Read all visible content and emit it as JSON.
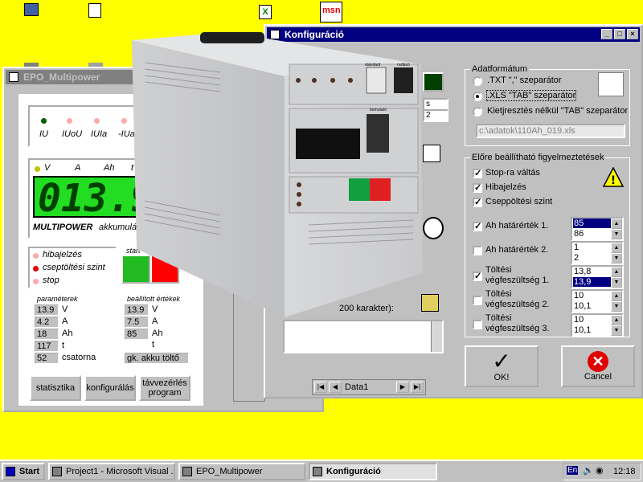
{
  "desktop": {
    "bg": "#ffff00",
    "msn_label": "msn"
  },
  "main_window": {
    "title": "EPO_Multipower",
    "indicators": [
      "IU",
      "IUoU",
      "IUIa",
      "-IUa"
    ],
    "meter_labels": [
      "V",
      "A",
      "Ah",
      "t"
    ],
    "display_value": "013.9",
    "brand": "MULTIPOWER",
    "brand_sub": "akkumuláto",
    "status_items": [
      "hibajelzés",
      "cseptöltési szint",
      "stop"
    ],
    "start_label": "start",
    "params_title": "paraméterek",
    "params": [
      {
        "value": "13.9",
        "unit": "V"
      },
      {
        "value": "4.2",
        "unit": "A"
      },
      {
        "value": "18",
        "unit": "Ah"
      },
      {
        "value": "117",
        "unit": "t"
      },
      {
        "value": "52",
        "unit": "csatorna"
      }
    ],
    "settings_title": "beállított értékek",
    "settings": [
      {
        "value": "13.9",
        "unit": "V"
      },
      {
        "value": "7.5",
        "unit": "A"
      },
      {
        "value": "85",
        "unit": "Ah"
      },
      {
        "value": "",
        "unit": "t"
      },
      {
        "value": "gk. akku töltő",
        "unit": ""
      }
    ],
    "btn_stat": "statisztika",
    "btn_config": "konfigurálás",
    "btn_remote": "távvezérlés program"
  },
  "config_window": {
    "title": "Konfiguráció",
    "data_format_title": "Adatformátum",
    "radio_options": [
      {
        "label": ".TXT  \",\" szeparátor",
        "selected": false
      },
      {
        "label": ".XLS \"TAB\" szeparátor",
        "selected": true
      },
      {
        "label": "Kietjresztés nélkül \"TAB\" szeparátor",
        "selected": false
      }
    ],
    "file_path": "c:\\adatok\\110Ah_019.xls",
    "warnings_title": "Előre beállítható figyelmeztetések",
    "checks": [
      {
        "label": "Stop-ra váltás",
        "checked": true
      },
      {
        "label": "Hibajelzés",
        "checked": true
      },
      {
        "label": "Cseppöltési szint",
        "checked": true
      }
    ],
    "limits": [
      {
        "label": "Ah határérték 1.",
        "checked": true,
        "v1": "85",
        "v2": "86",
        "sel1": true,
        "sel2": false
      },
      {
        "label": "Ah határérték 2.",
        "checked": false,
        "v1": "1",
        "v2": "2",
        "sel1": false,
        "sel2": false
      },
      {
        "label": "Töltési végfeszültség 1.",
        "checked": true,
        "v1": "13,8",
        "v2": "13,9",
        "sel1": false,
        "sel2": true
      },
      {
        "label": "Töltési végfeszültség 2.",
        "checked": false,
        "v1": "10",
        "v2": "10,1",
        "sel1": false,
        "sel2": false
      },
      {
        "label": "Töltési végfeszültség 3.",
        "checked": false,
        "v1": "10",
        "v2": "10,1",
        "sel1": false,
        "sel2": false
      }
    ],
    "ok_label": "OK!",
    "cancel_label": "Cancel",
    "comment_label": "200 karakter):",
    "nav_text": "Data1",
    "left_fields": [
      "s",
      "2"
    ]
  },
  "taskbar": {
    "start": "Start",
    "tasks": [
      "Project1 - Microsoft Visual ...",
      "EPO_Multipower",
      "Konfiguráció"
    ],
    "lang": "En",
    "time": "12:18"
  },
  "device": {
    "panel_labels": [
      "standard",
      "nullázó",
      "bemutató"
    ]
  },
  "colors": {
    "lcd": "#22dd22",
    "title_active": "#000080",
    "red": "#ff0000",
    "green": "#00a000"
  }
}
